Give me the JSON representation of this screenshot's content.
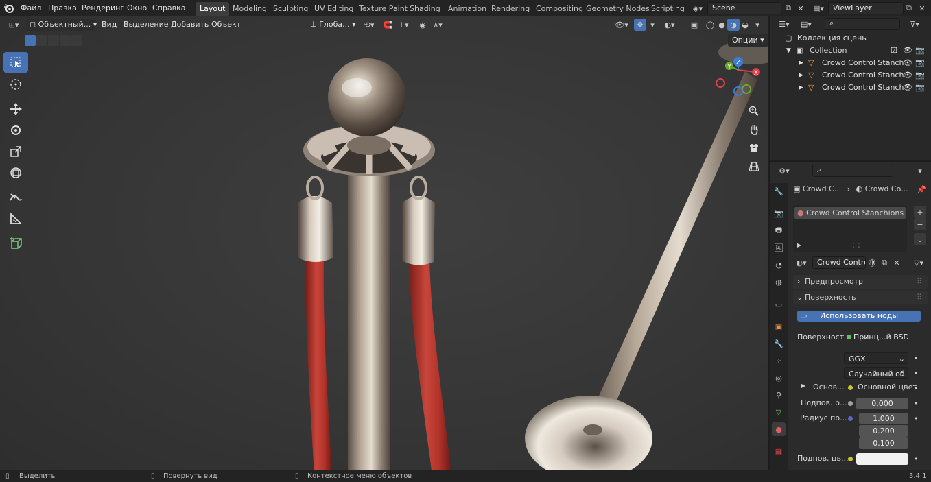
{
  "top_menu": [
    "Файл",
    "Правка",
    "Рендеринг",
    "Окно",
    "Справка"
  ],
  "workspace_tabs": [
    "Layout",
    "Modeling",
    "Sculpting",
    "UV Editing",
    "Texture Paint",
    "Shading",
    "Animation",
    "Rendering",
    "Compositing",
    "Geometry Nodes",
    "Scripting"
  ],
  "active_workspace": "Layout",
  "scene_name": "Scene",
  "view_layer": "ViewLayer",
  "viewport_header": {
    "mode": "Объектный...",
    "menus": [
      "Вид",
      "Выделение",
      "Добавить",
      "Объект"
    ],
    "orientation": "Глоба...",
    "options_label": "Опции"
  },
  "gizmo_axes": {
    "x": "X",
    "y": "Y",
    "z": "Z"
  },
  "outliner": {
    "scene_collection": "Коллекция сцены",
    "collection": "Collection",
    "objects": [
      "Crowd Control Stanch",
      "Crowd Control Stanch",
      "Crowd Control Stanch"
    ]
  },
  "properties": {
    "breadcrumb": [
      "Crowd C...",
      "Crowd Co..."
    ],
    "material_slot": "Crowd Control Stanchions",
    "material_name": "Crowd Contro...",
    "panel_preview": "Предпросмотр",
    "panel_surface": "Поверхность",
    "use_nodes_button": "Использовать ноды",
    "surface_label": "Поверхность",
    "surface_value": "Принц...й BSDF",
    "distribution": "GGX",
    "subsurface_method": "Случайный об...",
    "base_label": "Основ...",
    "base_value": "Основной цвет",
    "subsurface_label": "Подпов. р...",
    "subsurface_value": "0.000",
    "radius_label": "Радиус по...",
    "radius_values": [
      "1.000",
      "0.200",
      "0.100"
    ],
    "subsurface_color_label": "Подпов. цв..."
  },
  "status_bar": {
    "select": "Выделить",
    "rotate": "Повернуть вид",
    "context": "Контекстное меню объектов",
    "version": "3.4.1"
  },
  "colors": {
    "accent": "#4772b3",
    "rope": "#b5322a",
    "metal": "#a89a8a"
  }
}
